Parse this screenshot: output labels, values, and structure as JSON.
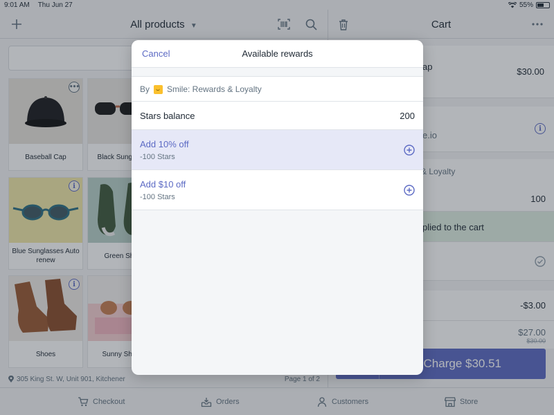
{
  "status_bar": {
    "time": "9:01 AM",
    "date": "Thu Jun 27",
    "battery": "55%"
  },
  "products": {
    "title": "All products",
    "items": [
      {
        "name": "Baseball Cap",
        "badge": "more"
      },
      {
        "name": "Black Sunglasses",
        "badge": ""
      },
      {
        "name": "Blue Sunglasses Auto renew",
        "badge": "info"
      },
      {
        "name": "Green Shoes",
        "badge": ""
      },
      {
        "name": "Shoes",
        "badge": "info"
      },
      {
        "name": "Sunny Shades",
        "badge": ""
      }
    ],
    "address": "305 King St. W, Unit 901, Kitchener",
    "page": "Page 1 of 2"
  },
  "cart": {
    "title": "Cart",
    "line_item_partial": "ap",
    "line_item_price": "$30.00",
    "customer_email_partial": "e.io",
    "loyalty_partial": "& Loyalty",
    "loyalty_value": "100",
    "applied_banner_partial": "plied to the cart",
    "discount": "-$3.00",
    "subtotal": "$27.00",
    "subtotal_original": "$30.00",
    "charge_label": "Charge $30.51"
  },
  "tabs": [
    {
      "label": "Checkout",
      "icon": "cart-icon"
    },
    {
      "label": "Orders",
      "icon": "inbox-icon"
    },
    {
      "label": "Customers",
      "icon": "person-icon"
    },
    {
      "label": "Store",
      "icon": "store-icon"
    }
  ],
  "modal": {
    "cancel_label": "Cancel",
    "title": "Available rewards",
    "provider_prefix": "By",
    "provider_name": "Smile: Rewards & Loyalty",
    "balance_label": "Stars balance",
    "balance_value": "200",
    "rewards": [
      {
        "title": "Add 10% off",
        "cost": "-100 Stars",
        "selected": true
      },
      {
        "title": "Add $10 off",
        "cost": "-100 Stars",
        "selected": false
      }
    ]
  },
  "colors": {
    "accent": "#5c6ac4",
    "selected_row": "#e6e8f7",
    "applied_banner": "#dfeee2",
    "loyalty_logo": "#fbc02d"
  }
}
